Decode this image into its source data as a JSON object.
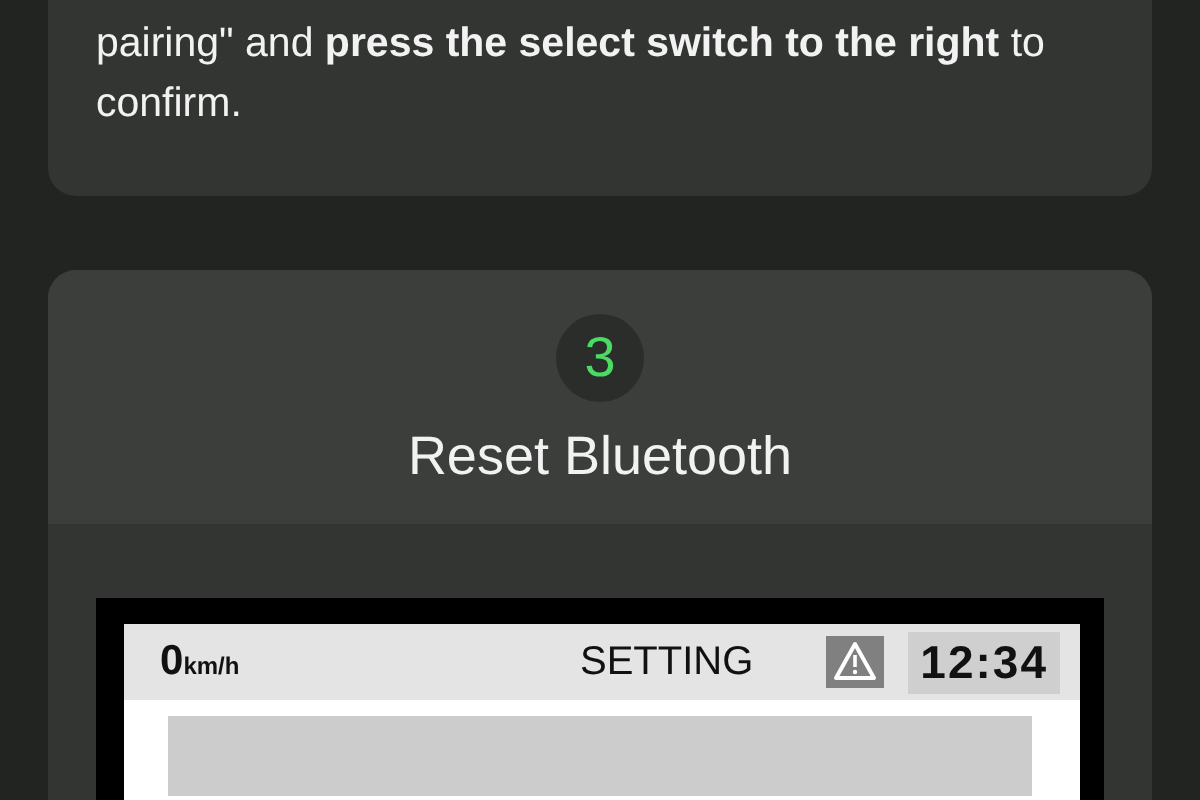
{
  "previous_step": {
    "instruction": "pairing\" and **press the select switch to the right** to confirm."
  },
  "step": {
    "number": "3",
    "title": "Reset Bluetooth",
    "display": {
      "speed": "0",
      "speed_unit": "km/h",
      "title": "SETTING",
      "time": "12:34"
    }
  }
}
